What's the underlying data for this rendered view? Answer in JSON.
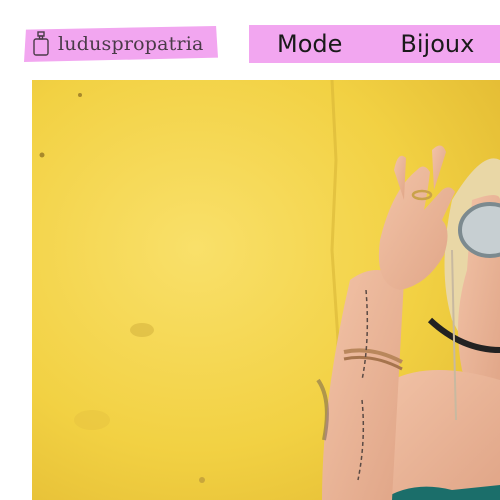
{
  "header": {
    "logo_text": "luduspropatria",
    "logo_icon": "perfume-bottle-icon",
    "nav": [
      {
        "label": "Mode"
      },
      {
        "label": "Bijoux"
      }
    ]
  },
  "colors": {
    "accent_pink": "#f2a6f0",
    "hero_wall_yellow": "#f4d447",
    "text_dark": "#1a1a1a"
  }
}
